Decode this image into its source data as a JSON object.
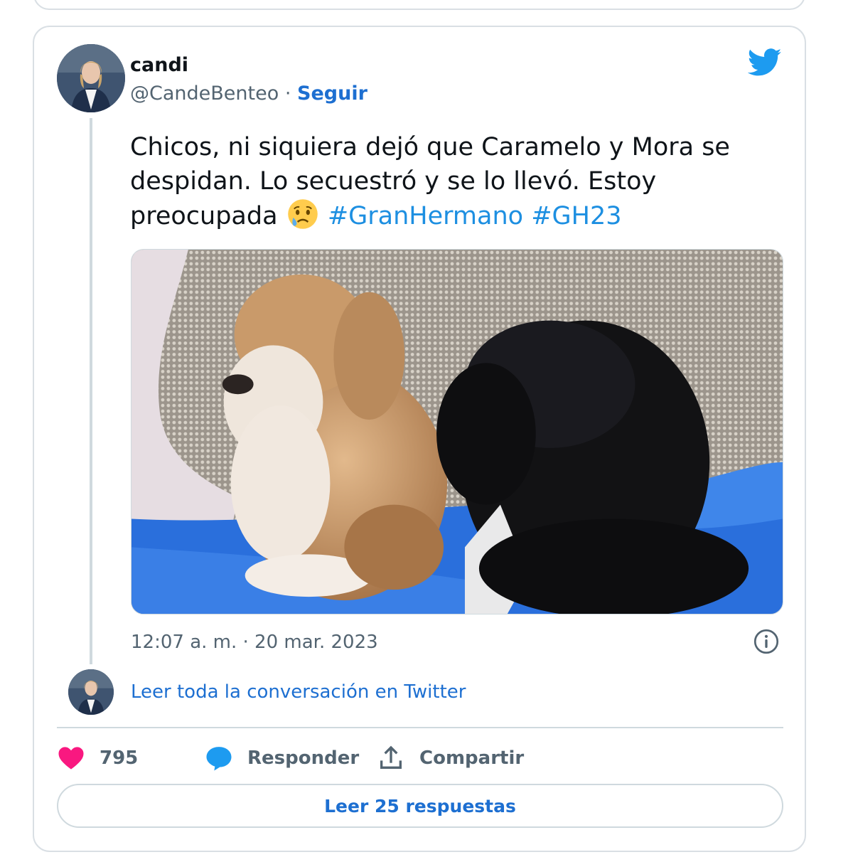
{
  "author": {
    "name": "candi",
    "handle": "@CandeBenteo",
    "separator": "·",
    "follow_label": "Seguir"
  },
  "tweet": {
    "text": "Chicos, ni siquiera dejó que Caramelo y Mora se despidan. Lo secuestró y se lo llevó. Estoy preocupada",
    "emoji": "sad-but-relieved-face",
    "hashtags": [
      "#GranHermano",
      "#GH23"
    ],
    "timestamp": "12:07 a. m. · 20 mar. 2023"
  },
  "read_conversation_label": "Leer toda la conversación en Twitter",
  "actions": {
    "likes_count": "795",
    "reply_label": "Responder",
    "share_label": "Compartir"
  },
  "read_replies_label": "Leer 25 respuestas",
  "colors": {
    "link": "#1d6fd1",
    "hashtag": "#1d8fe1",
    "like": "#f91880",
    "reply": "#1d9bf0",
    "twitter_brand": "#1d9bf0"
  }
}
